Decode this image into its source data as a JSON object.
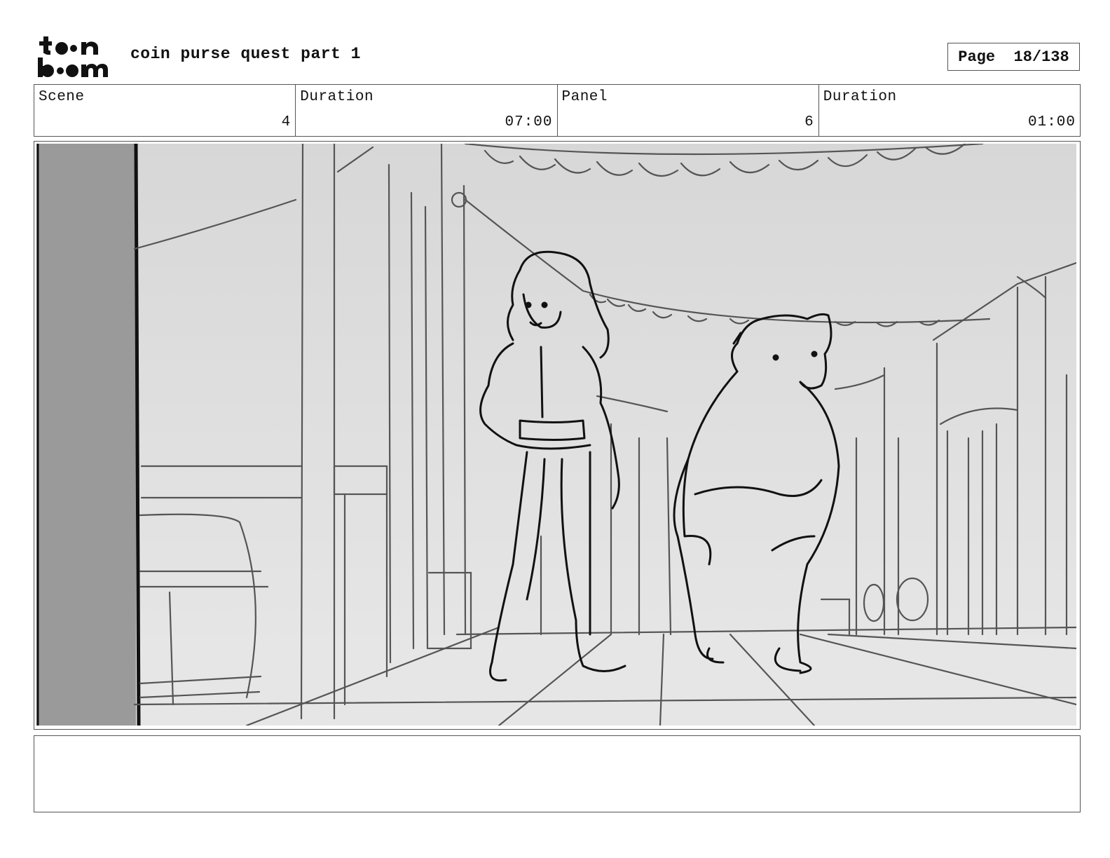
{
  "header": {
    "logo_text_top": "toon",
    "logo_text_bottom": "boom",
    "project_title": "coin purse quest part 1",
    "page_label": "Page",
    "page_number": "18/138"
  },
  "info": {
    "scene_label": "Scene",
    "scene_value": "4",
    "scene_duration_label": "Duration",
    "scene_duration_value": "07:00",
    "panel_label": "Panel",
    "panel_value": "6",
    "panel_duration_label": "Duration",
    "panel_duration_value": "01:00"
  },
  "panel": {
    "description": "",
    "notes": ""
  }
}
